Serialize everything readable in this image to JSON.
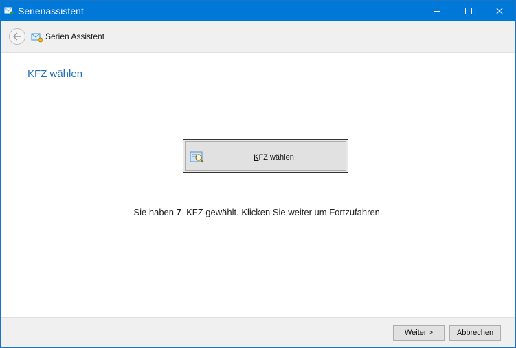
{
  "window": {
    "title": "Serienassistent"
  },
  "nav": {
    "title": "Serien Assistent"
  },
  "page": {
    "heading": "KFZ wählen",
    "select_button": {
      "label_first": "K",
      "label_rest": "FZ wählen"
    },
    "status": {
      "prefix": "Sie haben",
      "count": "7",
      "suffix": "KFZ gewählt. Klicken Sie weiter um Fortzufahren."
    }
  },
  "footer": {
    "next": {
      "label_first": "W",
      "label_rest": "eiter >"
    },
    "cancel": "Abbrechen"
  },
  "icons": {
    "app": "mail-wizard-icon",
    "back": "back-arrow-icon",
    "nav": "mail-wizard-icon",
    "select": "search-list-icon",
    "minimize": "minimize-icon",
    "maximize": "maximize-icon",
    "close": "close-icon"
  },
  "colors": {
    "titlebar": "#0078d7",
    "heading": "#1e6fb8"
  }
}
